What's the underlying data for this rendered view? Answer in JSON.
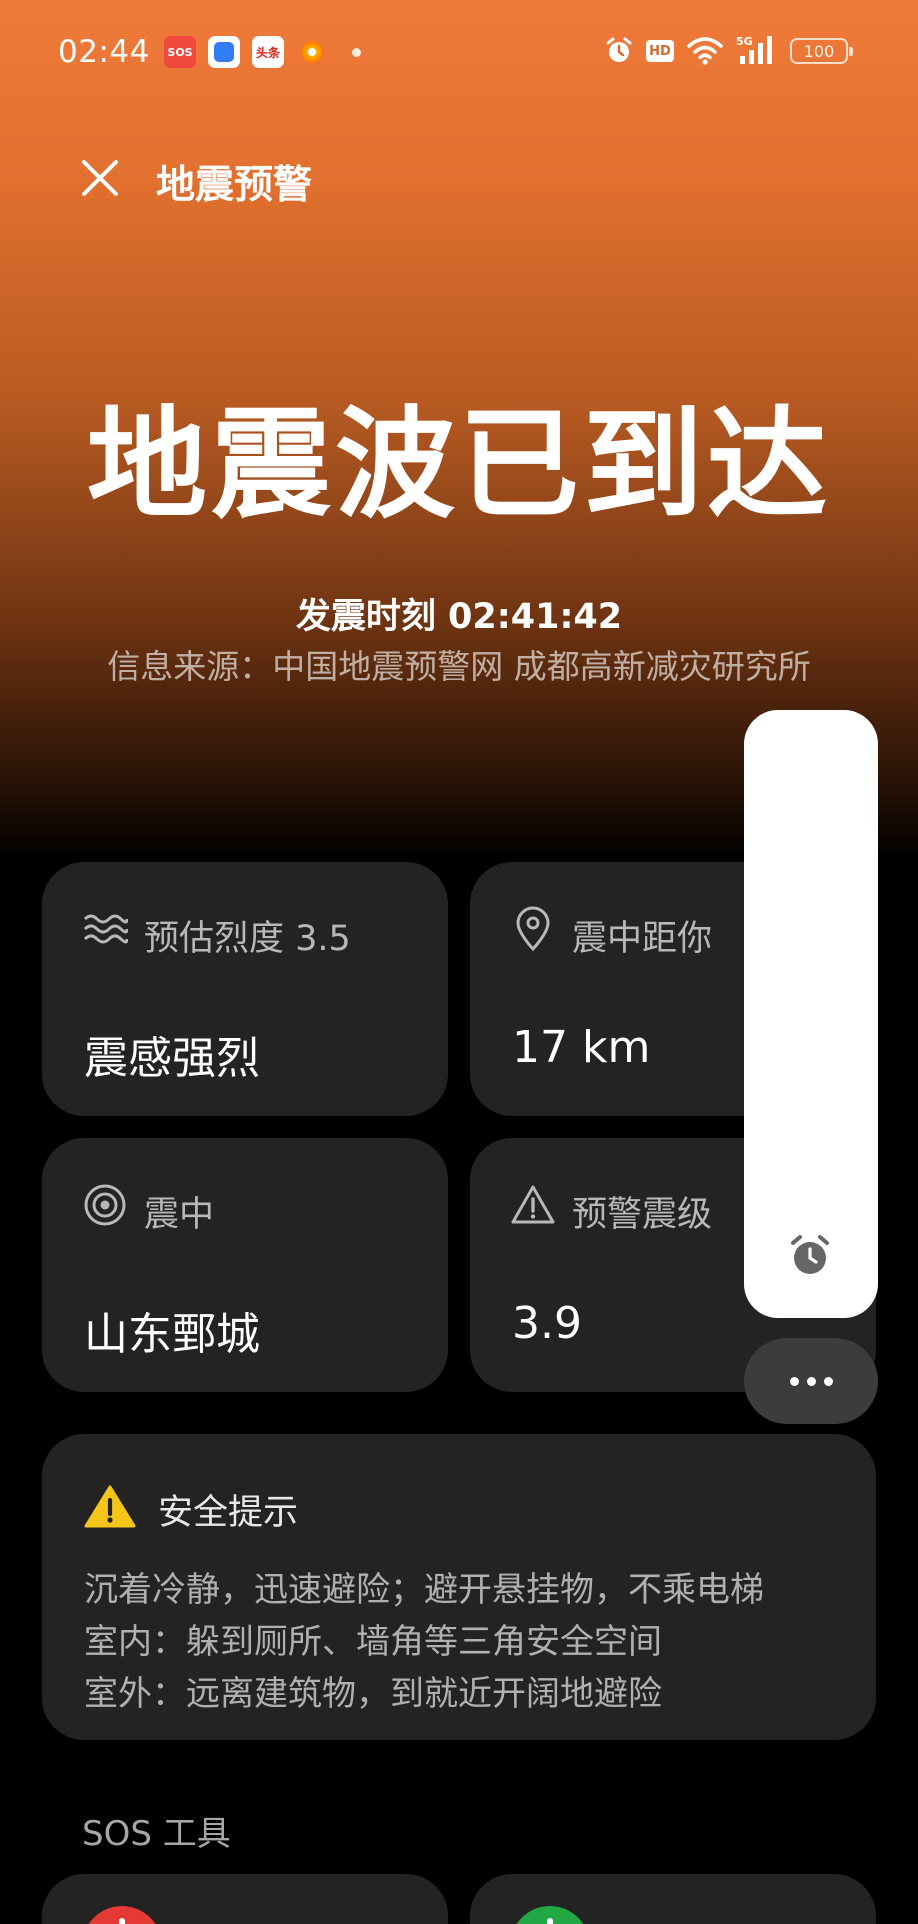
{
  "status_bar": {
    "time": "02:44",
    "notifications": [
      {
        "icon": "sos-app-icon",
        "text": "SOS"
      },
      {
        "icon": "blue-app-icon"
      },
      {
        "icon": "toutiao-app-icon",
        "text": "头条"
      },
      {
        "icon": "flower-app-icon"
      }
    ],
    "hd": "HD",
    "network": "5G",
    "battery": "100"
  },
  "header": {
    "title": "地震预警"
  },
  "hero": {
    "headline": "地震波已到达",
    "quake_time": "发震时刻 02:41:42",
    "source": "信息来源：中国地震预警网 成都高新减灾研究所"
  },
  "cards": [
    {
      "label": "预估烈度 3.5",
      "value": "震感强烈",
      "icon": "wave-icon"
    },
    {
      "label": "震中距你",
      "value": "17 km",
      "icon": "location-pin-icon"
    },
    {
      "label": "震中",
      "value": "山东鄄城",
      "icon": "target-icon"
    },
    {
      "label": "预警震级",
      "value": "3.9",
      "icon": "warning-triangle-icon"
    }
  ],
  "safety": {
    "title": "安全提示",
    "lines": [
      "沉着冷静，迅速避险；避开悬挂物，不乘电梯",
      "室内：躲到厕所、墙角等三角安全空间",
      "室外：远离建筑物，到就近开阔地避险"
    ]
  },
  "sos": {
    "label": "SOS 工具"
  },
  "colors": {
    "gradient_top": "#f07a3a",
    "gradient_mid": "#b85a22",
    "card_bg": "#232323",
    "warning_yellow": "#f5c518",
    "sos_red": "#e53935",
    "sos_green": "#22a745"
  }
}
